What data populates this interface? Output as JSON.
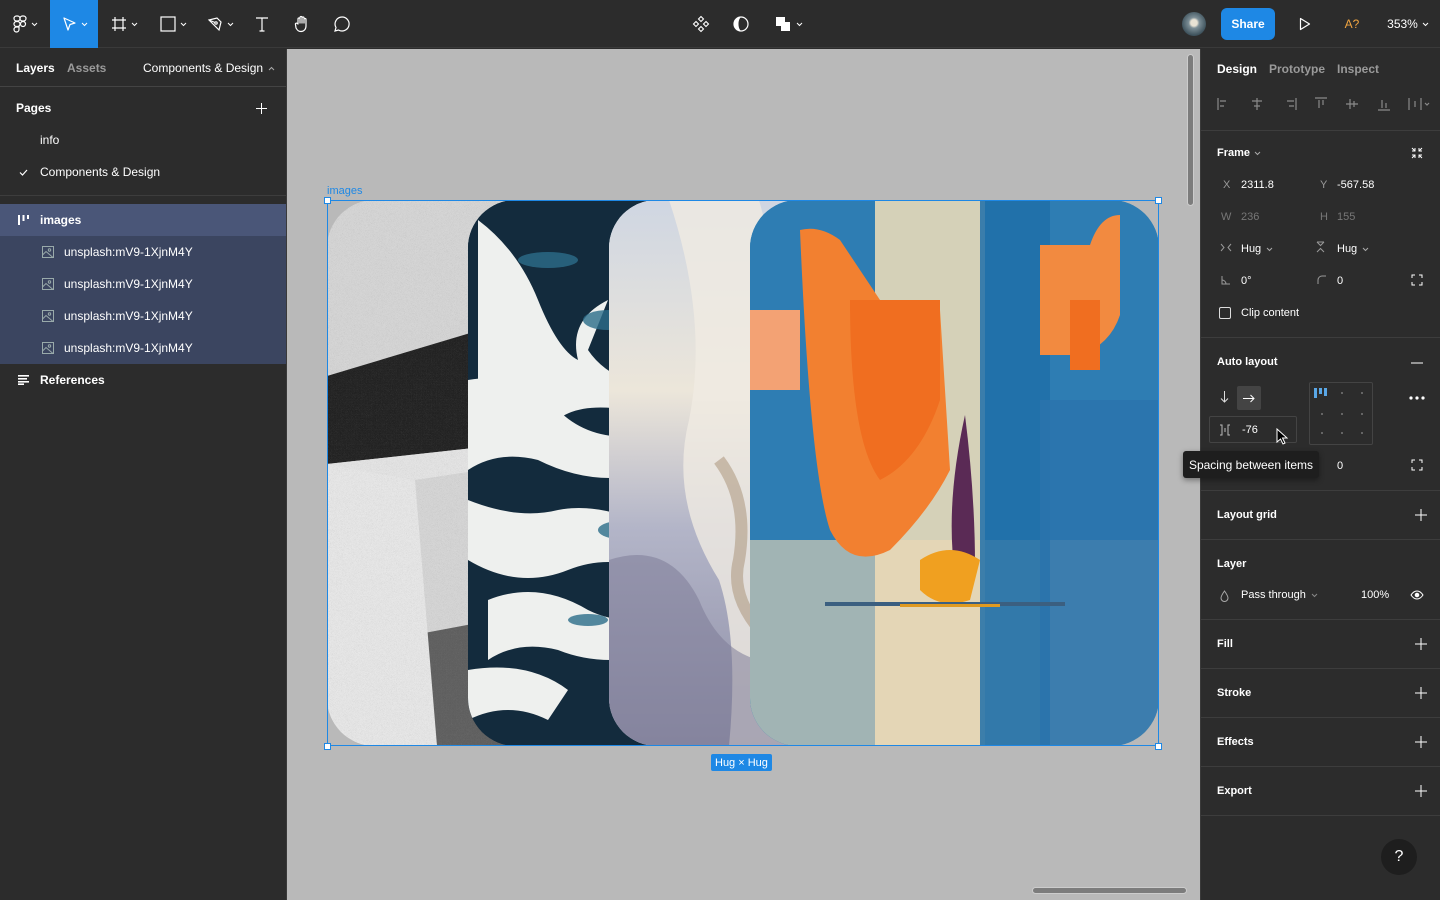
{
  "toolbar": {
    "tools": [
      {
        "name": "main-menu",
        "icon": "figma-logo-icon"
      },
      {
        "name": "move-tool",
        "icon": "cursor-arrow-icon",
        "active": true
      },
      {
        "name": "frame-tool",
        "icon": "frame-hash-icon"
      },
      {
        "name": "shape-tool",
        "icon": "rectangle-icon"
      },
      {
        "name": "pen-tool",
        "icon": "pen-icon"
      },
      {
        "name": "text-tool",
        "icon": "text-t-icon"
      },
      {
        "name": "hand-tool",
        "icon": "hand-icon"
      },
      {
        "name": "comment-tool",
        "icon": "comment-bubble-icon"
      }
    ],
    "center_tools": [
      {
        "name": "components",
        "icon": "components-diamond-icon"
      },
      {
        "name": "mask",
        "icon": "mask-contrast-icon"
      },
      {
        "name": "boolean",
        "icon": "boolean-union-icon"
      }
    ],
    "share_label": "Share",
    "present_icon": "play-triangle-icon",
    "font_warning": "A?",
    "zoom_level": "353%",
    "accent_color": "#1e88e5",
    "warning_color": "#f2a540"
  },
  "left_panel": {
    "tabs": {
      "layers": "Layers",
      "assets": "Assets"
    },
    "current_page": "Components & Design",
    "pages_label": "Pages",
    "pages": [
      {
        "label": "info",
        "selected": false
      },
      {
        "label": "Components & Design",
        "selected": true
      }
    ],
    "layers": [
      {
        "label": "images",
        "icon": "auto-layout-frame-icon",
        "level": 0,
        "selected": true
      },
      {
        "label": "unsplash:mV9-1XjnM4Y",
        "icon": "image-icon",
        "level": 1,
        "selected": true
      },
      {
        "label": "unsplash:mV9-1XjnM4Y",
        "icon": "image-icon",
        "level": 1,
        "selected": true
      },
      {
        "label": "unsplash:mV9-1XjnM4Y",
        "icon": "image-icon",
        "level": 1,
        "selected": true
      },
      {
        "label": "unsplash:mV9-1XjnM4Y",
        "icon": "image-icon",
        "level": 1,
        "selected": true
      },
      {
        "label": "References",
        "icon": "text-lines-icon",
        "level": 0,
        "selected": false
      }
    ]
  },
  "canvas": {
    "frame_label": "images",
    "size_badge": "Hug × Hug",
    "selection_color": "#1e88e5",
    "images": [
      {
        "name": "gray-texture-image"
      },
      {
        "name": "ocean-waves-image"
      },
      {
        "name": "white-fabric-image"
      },
      {
        "name": "abstract-painting-image"
      }
    ]
  },
  "right_panel": {
    "tabs": {
      "design": "Design",
      "prototype": "Prototype",
      "inspect": "Inspect"
    },
    "frame": {
      "title": "Frame",
      "x_label": "X",
      "x": "2311.8",
      "y_label": "Y",
      "y": "-567.58",
      "w_label": "W",
      "w": "236",
      "h_label": "H",
      "h": "155",
      "h_sizing": "Hug",
      "v_sizing": "Hug",
      "rotation": "0°",
      "radius": "0",
      "clip_content": "Clip content",
      "clip_checked": false
    },
    "auto_layout": {
      "title": "Auto layout",
      "direction": "horizontal",
      "spacing": "-76",
      "padding": "0",
      "tooltip": "Spacing between items"
    },
    "layout_grid": {
      "title": "Layout grid"
    },
    "layer": {
      "title": "Layer",
      "blend_mode": "Pass through",
      "opacity": "100%"
    },
    "fill": {
      "title": "Fill"
    },
    "stroke": {
      "title": "Stroke"
    },
    "effects": {
      "title": "Effects"
    },
    "export": {
      "title": "Export"
    },
    "help": "?"
  }
}
